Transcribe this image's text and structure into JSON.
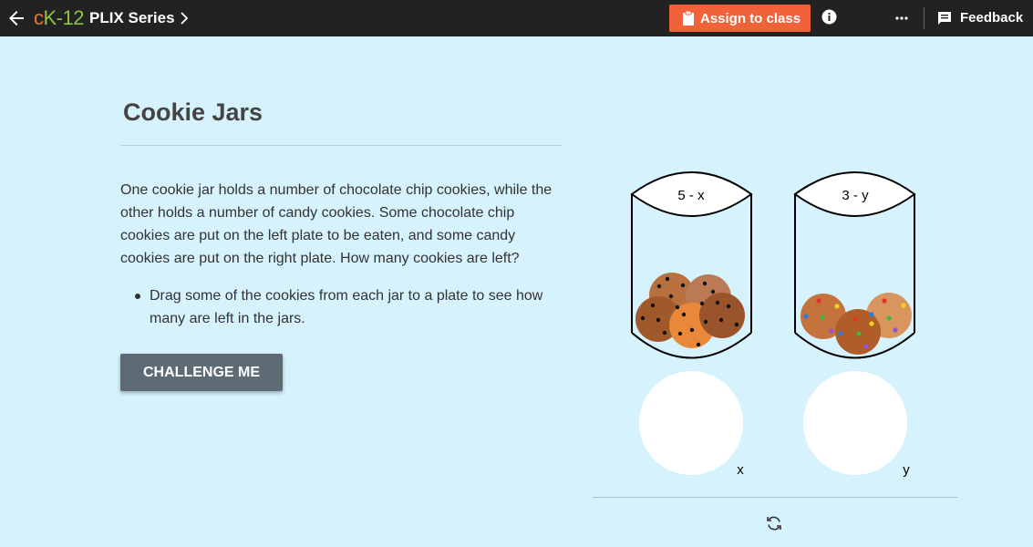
{
  "header": {
    "logo_c": "c",
    "logo_rest": "K-12",
    "series_label": "PLIX Series",
    "assign_label": "Assign to class",
    "feedback_label": "Feedback",
    "accent_color": "#f0623a",
    "icons": [
      "back-arrow-icon",
      "chevron-right-icon",
      "clipboard-icon",
      "info-icon",
      "more-icon",
      "feedback-icon"
    ]
  },
  "main": {
    "title": "Cookie Jars",
    "description": "One cookie jar holds a number of chocolate chip cookies, while the other holds a number of candy cookies. Some chocolate chip cookies are put on the left plate to be eaten, and some candy cookies are put on the right plate. How many cookies are left?",
    "bullets": [
      "Drag some of the cookies from each jar to a plate to see how many are left in the jars."
    ],
    "challenge_label": "CHALLENGE ME"
  },
  "simulation": {
    "left_jar_label": "5 - x",
    "right_jar_label": "3 - y",
    "left_plate_label": "x",
    "right_plate_label": "y",
    "reset_icon": "refresh-icon"
  }
}
